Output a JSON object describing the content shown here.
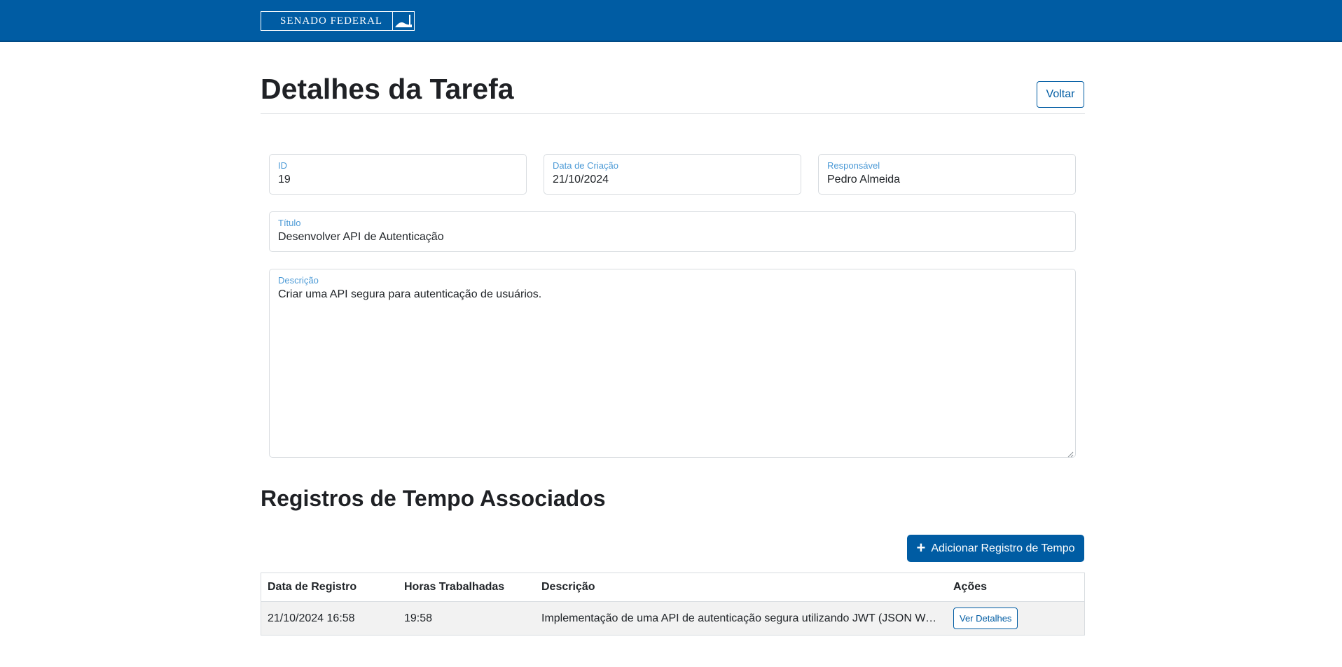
{
  "header": {
    "logo_text": "SENADO FEDERAL",
    "logo_icon": "senado-building-icon",
    "bar_color": "#005ca3"
  },
  "page": {
    "title": "Detalhes da Tarefa",
    "back_label": "Voltar"
  },
  "form": {
    "id": {
      "label": "ID",
      "value": "19"
    },
    "data_criacao": {
      "label": "Data de Criação",
      "value": "21/10/2024"
    },
    "responsavel": {
      "label": "Responsável",
      "value": "Pedro Almeida"
    },
    "titulo": {
      "label": "Título",
      "value": "Desenvolver API de Autenticação"
    },
    "descricao": {
      "label": "Descrição",
      "value": "Criar uma API segura para autenticação de usuários."
    }
  },
  "registros": {
    "section_title": "Registros de Tempo Associados",
    "add_button_label": "Adicionar Registro de Tempo",
    "add_button_icon": "plus-icon",
    "columns": [
      "Data de Registro",
      "Horas Trabalhadas",
      "Descrição",
      "Ações"
    ],
    "rows": [
      {
        "data_registro": "21/10/2024 16:58",
        "horas": "19:58",
        "descricao": "Implementação de uma API de autenticação segura utilizando JWT (JSON Web Tokens)",
        "acao_label": "Ver Detalhes"
      }
    ]
  },
  "colors": {
    "accent": "#005ca3",
    "label": "#4c9ad6",
    "row_bg": "#f2f2f2"
  }
}
